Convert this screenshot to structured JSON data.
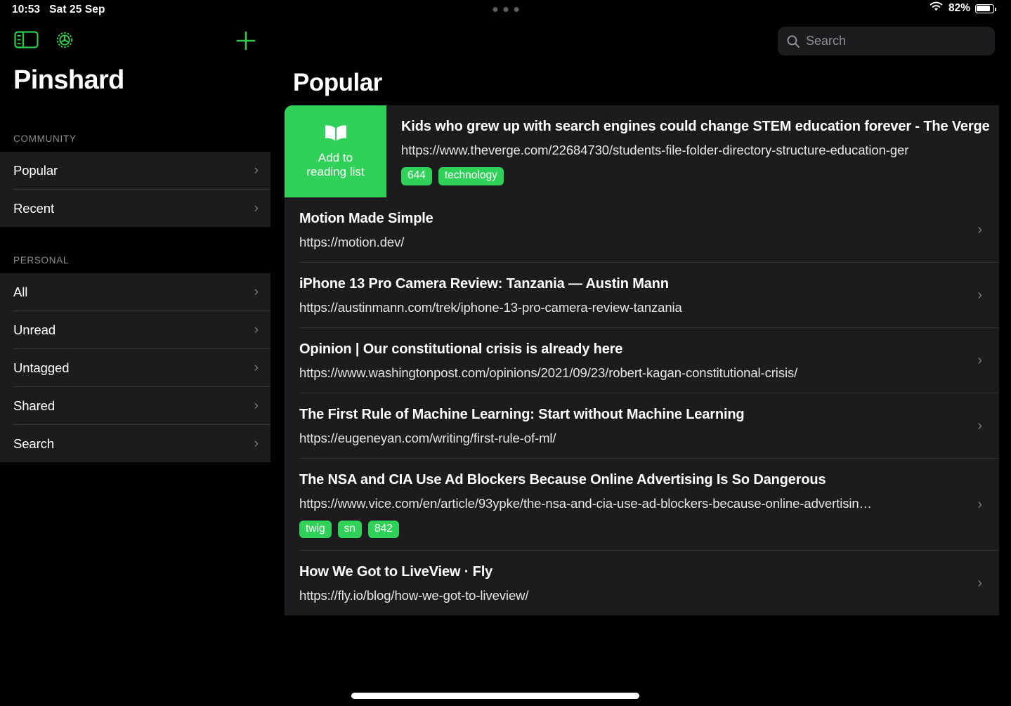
{
  "status_bar": {
    "time": "10:53",
    "date": "Sat 25 Sep",
    "battery_percent": "82%",
    "wifi_icon": "wifi-icon",
    "battery_icon": "battery-icon",
    "multitask_handle": "multitasking-dots"
  },
  "colors": {
    "accent_green": "#30d158",
    "row_bg": "#1c1c1e",
    "page_bg": "#000000",
    "separator": "#38383a",
    "secondary_text": "#8e8e93"
  },
  "sidebar": {
    "app_title": "Pinshard",
    "toolbar": {
      "sidebar_toggle_icon": "sidebar-toggle-icon",
      "settings_icon": "gear-icon",
      "add_icon": "plus-icon"
    },
    "sections": [
      {
        "header": "COMMUNITY",
        "items": [
          {
            "label": "Popular",
            "chevron": "›"
          },
          {
            "label": "Recent",
            "chevron": "›"
          }
        ]
      },
      {
        "header": "PERSONAL",
        "items": [
          {
            "label": "All",
            "chevron": "›"
          },
          {
            "label": "Unread",
            "chevron": "›"
          },
          {
            "label": "Untagged",
            "chevron": "›"
          },
          {
            "label": "Shared",
            "chevron": "›"
          },
          {
            "label": "Search",
            "chevron": "›"
          }
        ]
      }
    ]
  },
  "search": {
    "placeholder": "Search",
    "value": "",
    "icon": "search-icon"
  },
  "main": {
    "title": "Popular",
    "swipe_action": {
      "label_line1": "Add to",
      "label_line2": "reading list",
      "icon": "book-icon"
    },
    "bookmarks": [
      {
        "title": "Kids who grew up with search engines could change STEM education forever - The Verge",
        "url": "https://www.theverge.com/22684730/students-file-folder-directory-structure-education-ger",
        "tags": [
          "644",
          "technology"
        ],
        "swiped": true
      },
      {
        "title": "Motion Made Simple",
        "url": "https://motion.dev/",
        "tags": [],
        "swiped": false
      },
      {
        "title": "iPhone 13 Pro Camera Review: Tanzania — Austin Mann",
        "url": "https://austinmann.com/trek/iphone-13-pro-camera-review-tanzania",
        "tags": [],
        "swiped": false
      },
      {
        "title": "Opinion | Our constitutional crisis is already here",
        "url": "https://www.washingtonpost.com/opinions/2021/09/23/robert-kagan-constitutional-crisis/",
        "tags": [],
        "swiped": false
      },
      {
        "title": "The First Rule of Machine Learning: Start without Machine Learning",
        "url": "https://eugeneyan.com/writing/first-rule-of-ml/",
        "tags": [],
        "swiped": false
      },
      {
        "title": "The NSA and CIA Use Ad Blockers Because Online Advertising Is So Dangerous",
        "url": "https://www.vice.com/en/article/93ypke/the-nsa-and-cia-use-ad-blockers-because-online-advertisin…",
        "tags": [
          "twig",
          "sn",
          "842"
        ],
        "swiped": false
      },
      {
        "title": "How We Got to LiveView · Fly",
        "url": "https://fly.io/blog/how-we-got-to-liveview/",
        "tags": [],
        "swiped": false
      }
    ]
  }
}
